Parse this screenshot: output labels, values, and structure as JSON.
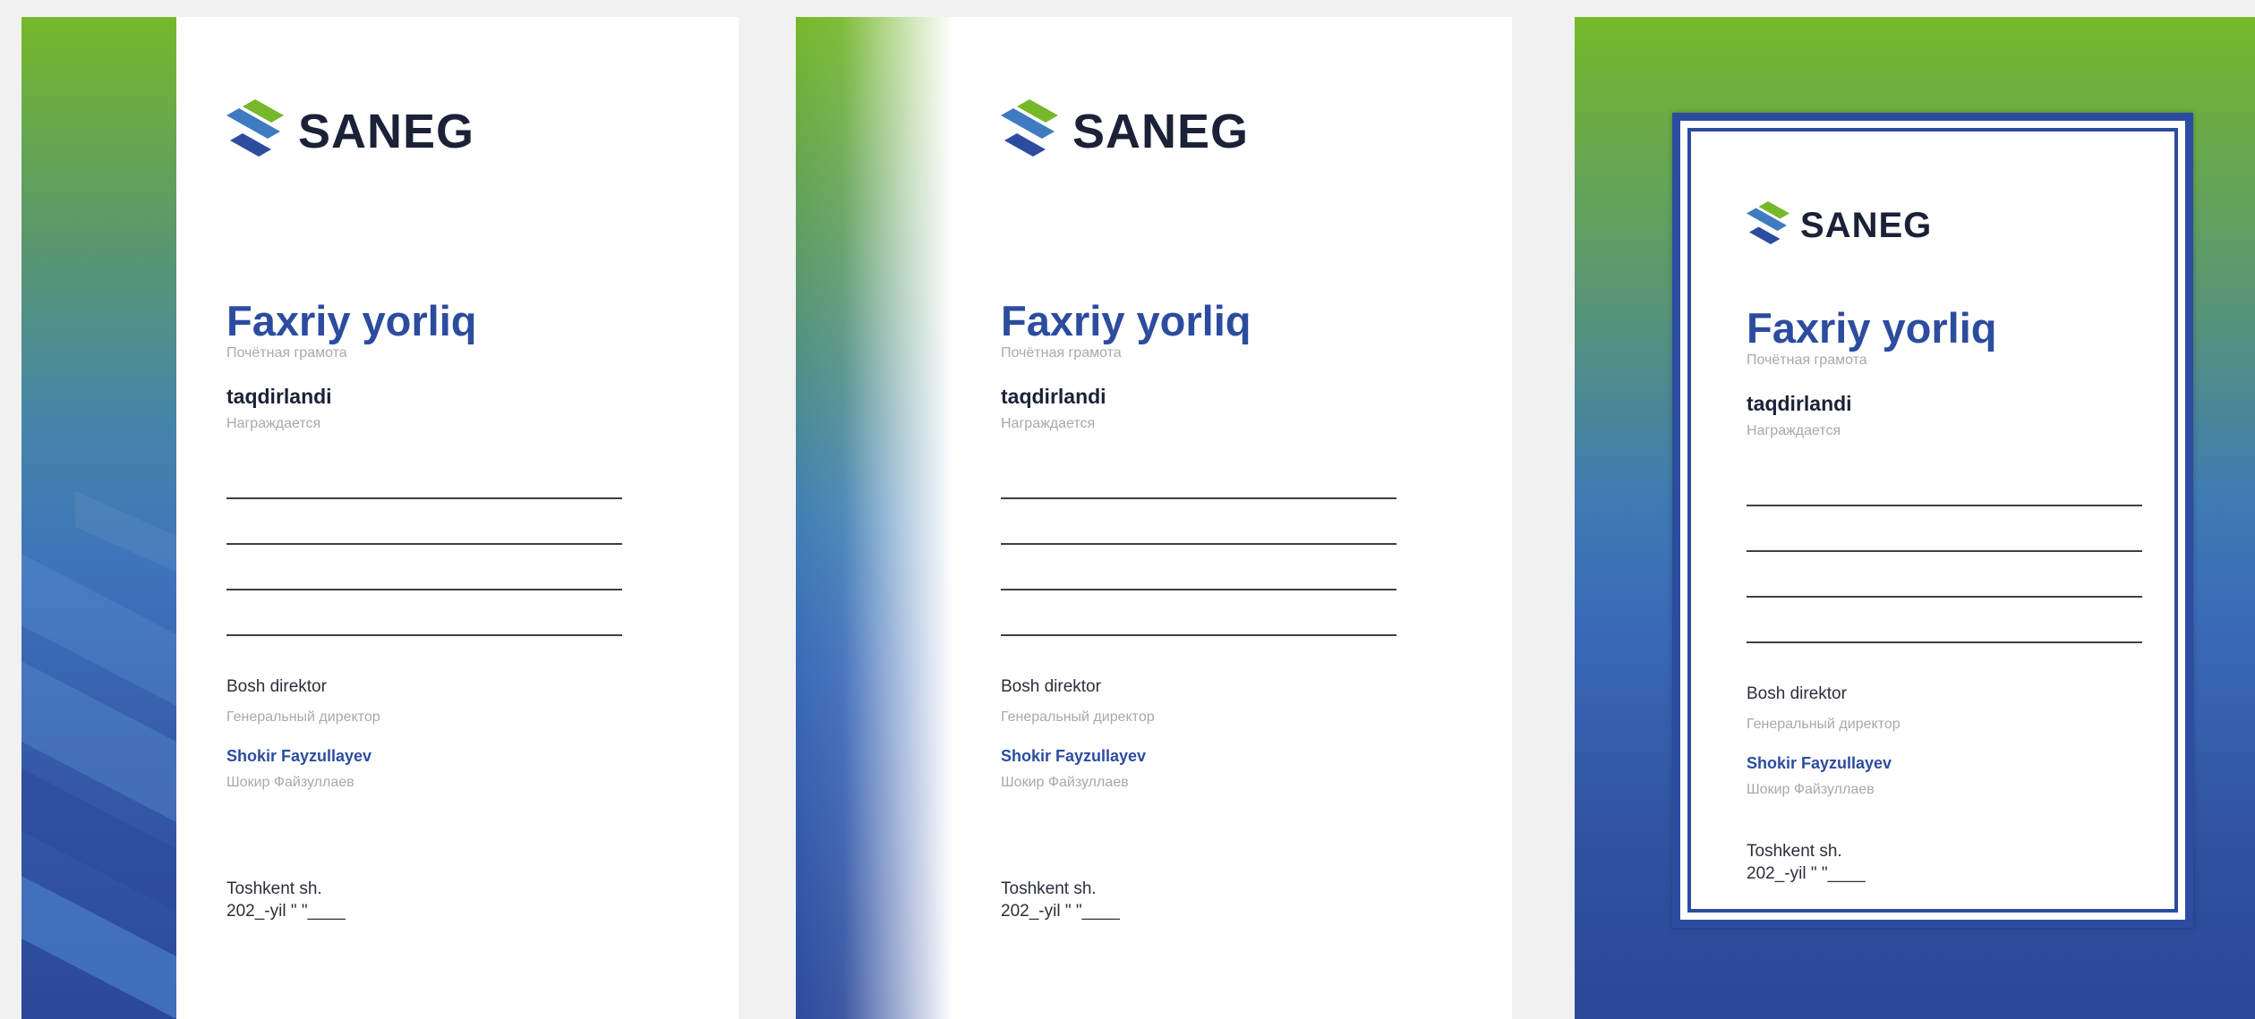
{
  "brand": {
    "name": "SANEG",
    "colors": {
      "green": "#76b82a",
      "blue": "#2c4c9f",
      "light_blue": "#3f7bc0",
      "dark": "#1b2136"
    }
  },
  "certificate": {
    "title": "Faxriy yorliq",
    "title_ru": "Почётная грамота",
    "awarded": "taqdirlandi",
    "awarded_ru": "Награждается",
    "position": "Bosh direktor",
    "position_ru": "Генеральный директор",
    "signatory": "Shokir Fayzullayev",
    "signatory_ru": "Шокир Файзуллаев",
    "city": "Toshkent sh.",
    "date": "202_-yil \"  \"____"
  },
  "variants": [
    {
      "style": "diagonal-stripes"
    },
    {
      "style": "gradient-fade"
    },
    {
      "style": "framed"
    }
  ]
}
